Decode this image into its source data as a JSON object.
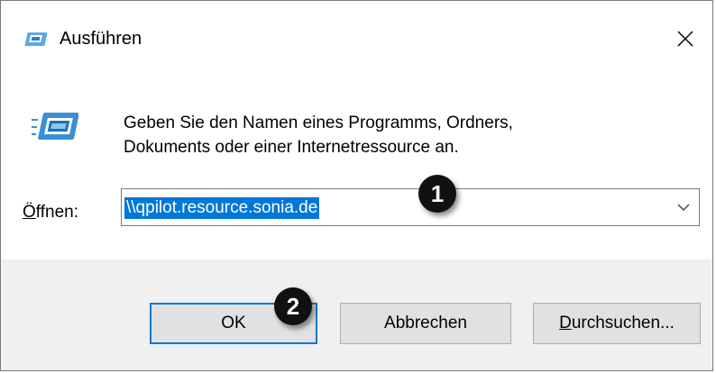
{
  "dialog": {
    "title": "Ausführen",
    "description_line1": "Geben Sie den Namen eines Programms, Ordners,",
    "description_line2": "Dokuments oder einer Internetressource an.",
    "open_label_accel": "Ö",
    "open_label_rest": "ffnen:",
    "open_value": "\\\\qpilot.resource.sonia.de",
    "buttons": {
      "ok": "OK",
      "cancel": "Abbrechen",
      "browse_accel": "D",
      "browse_rest": "urchsuchen..."
    }
  },
  "annotations": {
    "badge_1": "1",
    "badge_2": "2"
  },
  "icons": {
    "title_icon": "run-icon",
    "big_icon": "run-icon",
    "close": "close-icon",
    "combo_arrow": "chevron-down-icon"
  },
  "colors": {
    "selection": "#0078d7",
    "footer_bg": "#f0f0f0",
    "button_bg": "#e1e1e1",
    "default_button_border": "#0078d7",
    "badge": "#111111"
  }
}
